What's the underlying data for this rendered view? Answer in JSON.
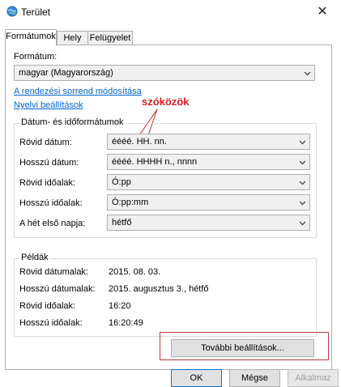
{
  "window": {
    "title": "Terület",
    "close_glyph": "✕"
  },
  "tabs": [
    {
      "label": "Formátumok",
      "active": true
    },
    {
      "label": "Hely",
      "active": false
    },
    {
      "label": "Felügyelet",
      "active": false
    }
  ],
  "format": {
    "label": "Formátum:",
    "value": "magyar (Magyarország)"
  },
  "links": {
    "sort_order": "A rendezési sorrend módosítása",
    "language_settings": "Nyelvi beállítások"
  },
  "annotation": {
    "text": "szóközök",
    "color": "#d42020"
  },
  "datetime_group": {
    "title": "Dátum- és időformátumok",
    "rows": [
      {
        "label": "Rövid dátum:",
        "value": "éééé. HH. nn."
      },
      {
        "label": "Hosszú dátum:",
        "value": "éééé. HHHH n., nnnn"
      },
      {
        "label": "Rövid időalak:",
        "value": "Ó:pp"
      },
      {
        "label": "Hosszú időalak:",
        "value": "Ó:pp:mm"
      },
      {
        "label": "A hét első napja:",
        "value": "hétfő"
      }
    ]
  },
  "examples_group": {
    "title": "Példák",
    "rows": [
      {
        "label": "Rövid dátumalak:",
        "value": "2015. 08. 03."
      },
      {
        "label": "Hosszú dátumalak:",
        "value": "2015. augusztus 3., hétfő"
      },
      {
        "label": "Rövid időalak:",
        "value": "16:20"
      },
      {
        "label": "Hosszú időalak:",
        "value": "16:20:49"
      }
    ]
  },
  "buttons": {
    "more_settings": "További beállítások...",
    "ok": "OK",
    "cancel": "Mégse",
    "apply": "Alkalmaz"
  },
  "icons": {
    "app": "globe-icon",
    "dropdown": "chevron-down-icon",
    "close": "close-icon"
  }
}
